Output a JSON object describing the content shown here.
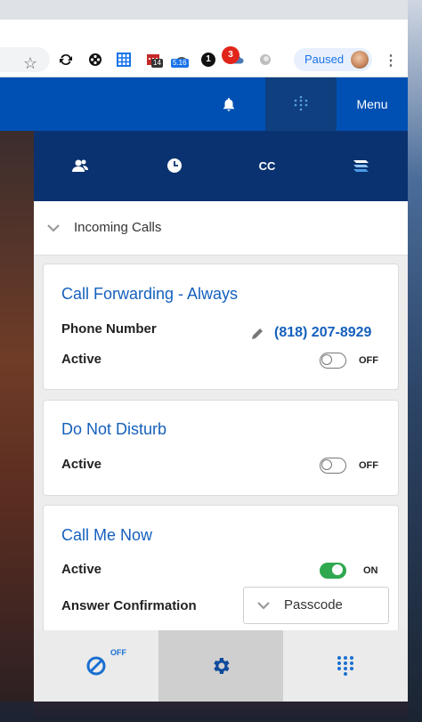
{
  "browser": {
    "profile_chip_label": "Paused",
    "extensions": [
      {
        "name": "sync-icon"
      },
      {
        "name": "film-reel-icon"
      },
      {
        "name": "grid-icon"
      },
      {
        "name": "calendar-extension-icon",
        "badge": "14"
      },
      {
        "name": "speed-gauge-icon",
        "badge": "5.16"
      },
      {
        "name": "onepassword-icon",
        "glyph": "1"
      },
      {
        "name": "cloud-icon"
      },
      {
        "name": "circle-icon"
      }
    ]
  },
  "appbar": {
    "notification_count": "3",
    "menu_label": "Menu"
  },
  "panel": {
    "icon_row": [
      {
        "name": "contacts-icon"
      },
      {
        "name": "history-clock-icon"
      },
      {
        "name": "cc-icon",
        "label": "CC"
      },
      {
        "name": "layers-icon"
      }
    ],
    "section_title": "Incoming Calls",
    "cards": {
      "call_forwarding": {
        "title": "Call Forwarding - Always",
        "phone_label": "Phone Number",
        "phone_value": "(818) 207-8929",
        "active_label": "Active",
        "active_state": "OFF"
      },
      "do_not_disturb": {
        "title": "Do Not Disturb",
        "active_label": "Active",
        "active_state": "OFF"
      },
      "call_me_now": {
        "title": "Call Me Now",
        "active_label": "Active",
        "active_state": "ON",
        "answer_label": "Answer Confirmation",
        "answer_value": "Passcode"
      }
    }
  },
  "bottom_bar": {
    "dnd_state": "OFF"
  },
  "colors": {
    "brand_blue": "#0050b3",
    "dark_navy": "#0a3270",
    "link_blue": "#1560bd",
    "toggle_on": "#2fa84f",
    "badge_red": "#e1251b"
  }
}
